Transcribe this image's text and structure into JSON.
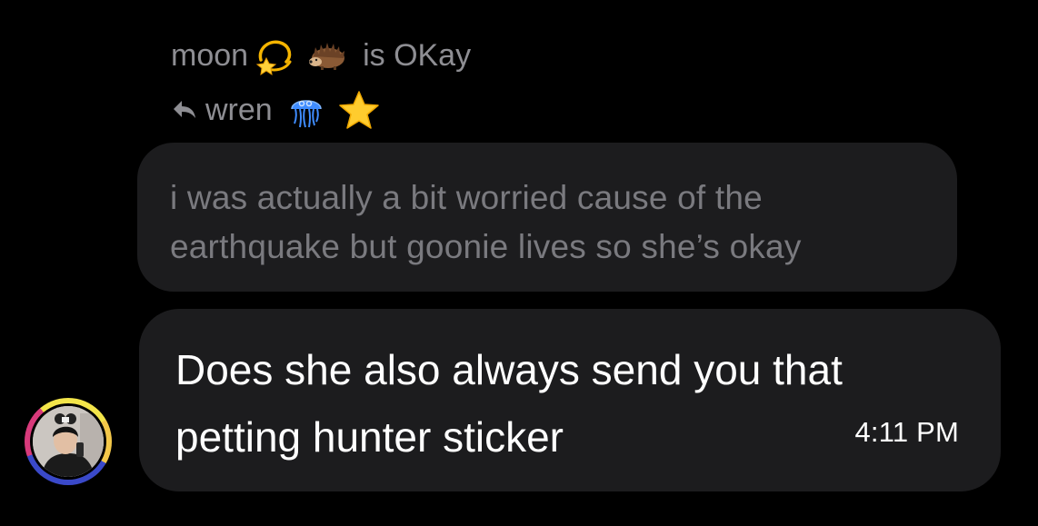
{
  "header": {
    "name_prefix": "moon",
    "status_suffix": "is OKay",
    "emoji_1": "dizzy-star-icon",
    "emoji_2": "hedgehog-icon"
  },
  "reply": {
    "name": "wren",
    "emoji_1": "jellyfish-icon",
    "emoji_2": "star-icon"
  },
  "quoted_message": {
    "text": "i was actually a bit worried cause of the earthquake but goonie lives so she’s okay"
  },
  "message": {
    "text": "Does she also always send you that petting hunter sticker",
    "timestamp": "4:11 PM"
  },
  "colors": {
    "background": "#000000",
    "bubble": "#1c1c1e",
    "muted_text": "#8e8e93",
    "primary_text": "#ffffff"
  }
}
